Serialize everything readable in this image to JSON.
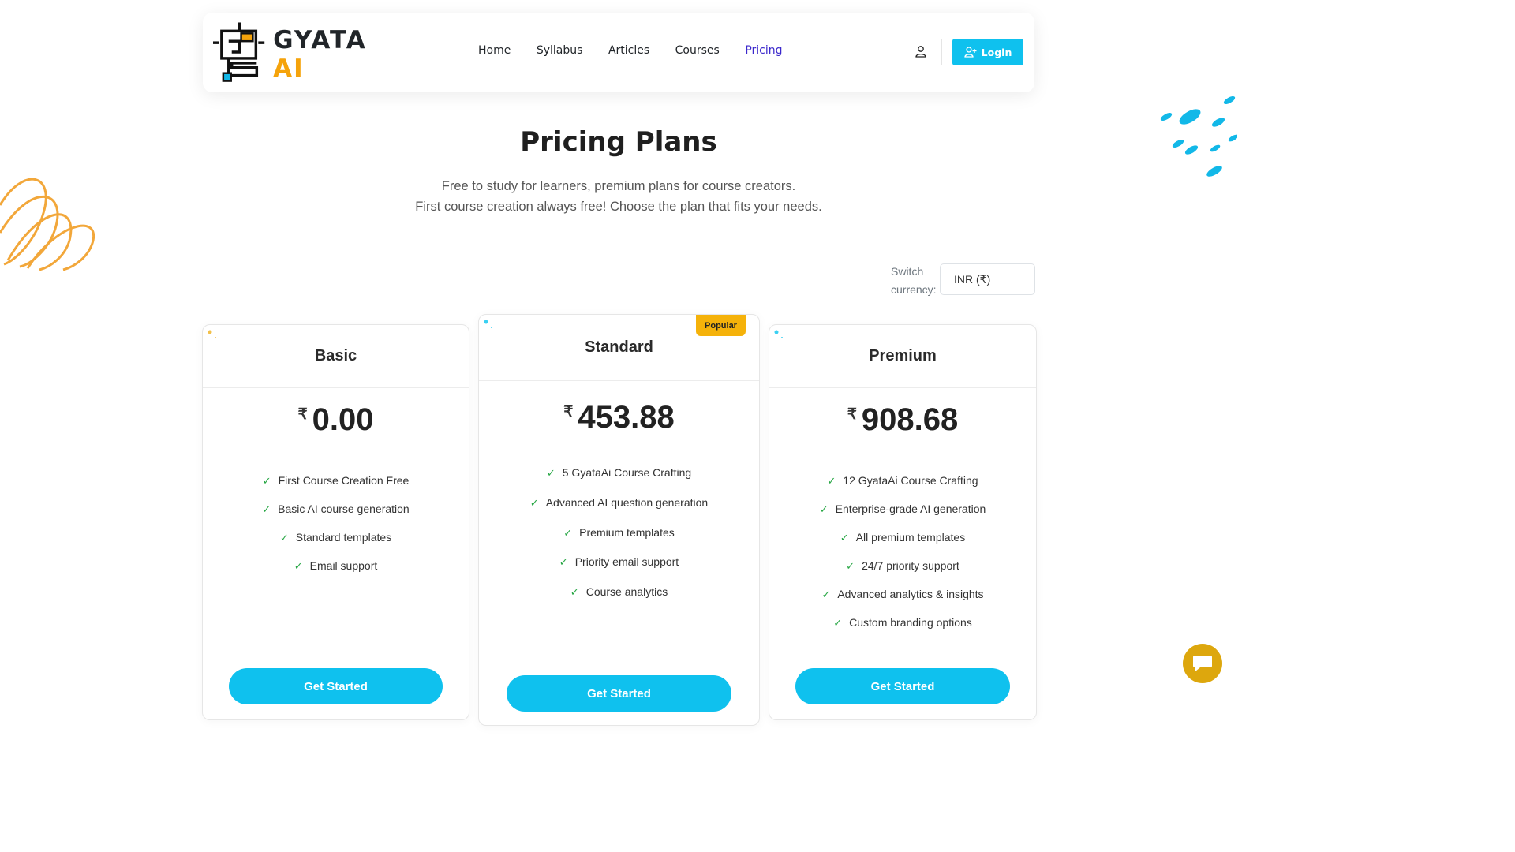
{
  "brand": {
    "name_main": "GYATA",
    "name_accent": "AI",
    "accent_color": "#f5a30b"
  },
  "nav": {
    "items": [
      {
        "label": "Home"
      },
      {
        "label": "Syllabus"
      },
      {
        "label": "Articles"
      },
      {
        "label": "Courses"
      },
      {
        "label": "Pricing",
        "active": true
      }
    ],
    "login_label": "Login",
    "user_icon": "user-icon",
    "login_icon": "user-plus-icon"
  },
  "hero": {
    "title": "Pricing Plans",
    "subtitle_line1": "Free to study for learners, premium plans for course creators.",
    "subtitle_line2": "First course creation always free! Choose the plan that fits your needs."
  },
  "currency": {
    "label_line1": "Switch",
    "label_line2": "currency:",
    "selected": "INR (₹)"
  },
  "plans": [
    {
      "name": "Basic",
      "currency_symbol": "₹",
      "price": "0.00",
      "features": [
        "First Course Creation Free",
        "Basic AI course generation",
        "Standard templates",
        "Email support"
      ],
      "cta": "Get Started"
    },
    {
      "name": "Standard",
      "badge": "Popular",
      "currency_symbol": "₹",
      "price": "453.88",
      "features": [
        "5 GyataAi Course Crafting",
        "Advanced AI question generation",
        "Premium templates",
        "Priority email support",
        "Course analytics"
      ],
      "cta": "Get Started"
    },
    {
      "name": "Premium",
      "currency_symbol": "₹",
      "price": "908.68",
      "features": [
        "12 GyataAi Course Crafting",
        "Enterprise-grade AI generation",
        "All premium templates",
        "24/7 priority support",
        "Advanced analytics & insights",
        "Custom branding options"
      ],
      "cta": "Get Started"
    }
  ],
  "colors": {
    "primary": "#0fc1ee",
    "nav_active": "#3b28cc",
    "popular_badge": "#f5b20a",
    "check": "#28a745",
    "chat": "#dda70d"
  },
  "chat": {
    "icon": "chat-bubble-icon"
  }
}
